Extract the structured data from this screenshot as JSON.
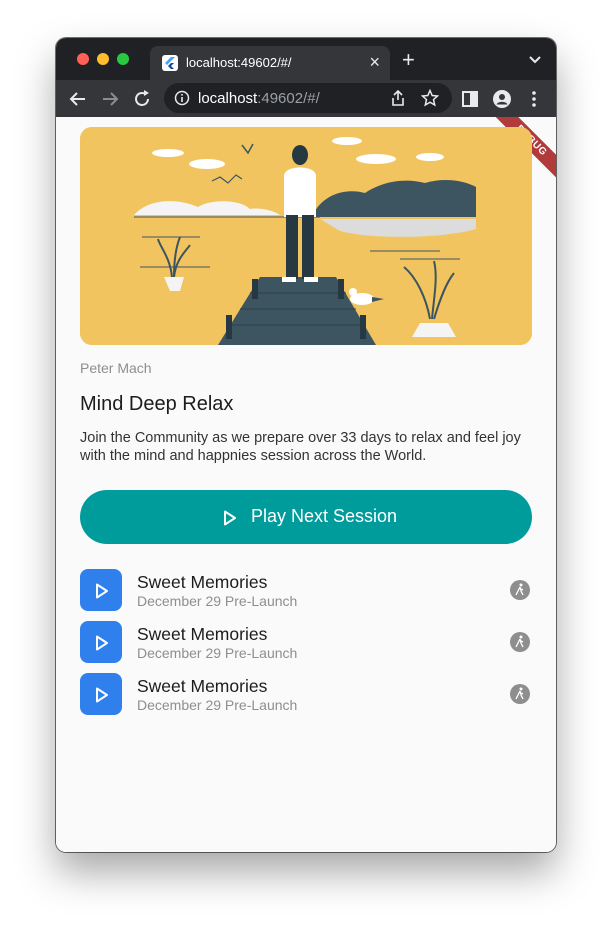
{
  "browser": {
    "tab_title": "localhost:49602/#/",
    "tab_close": "×",
    "new_tab": "+",
    "url_host": "localhost",
    "url_rest": ":49602/#/"
  },
  "debug_banner": "DEBUG",
  "card": {
    "author": "Peter Mach",
    "title": "Mind Deep Relax",
    "description": "Join the Community as we prepare over 33 days to relax and feel joy with the mind and happnies session across the World."
  },
  "play_button": {
    "label": "Play Next Session",
    "color": "#009b9b"
  },
  "sessions": [
    {
      "title": "Sweet Memories",
      "subtitle": "December 29 Pre-Launch"
    },
    {
      "title": "Sweet Memories",
      "subtitle": "December 29 Pre-Launch"
    },
    {
      "title": "Sweet Memories",
      "subtitle": "December 29 Pre-Launch"
    }
  ],
  "colors": {
    "hero_bg": "#f2c45f",
    "thumb": "#2f80ed",
    "accent": "#009b9b"
  }
}
